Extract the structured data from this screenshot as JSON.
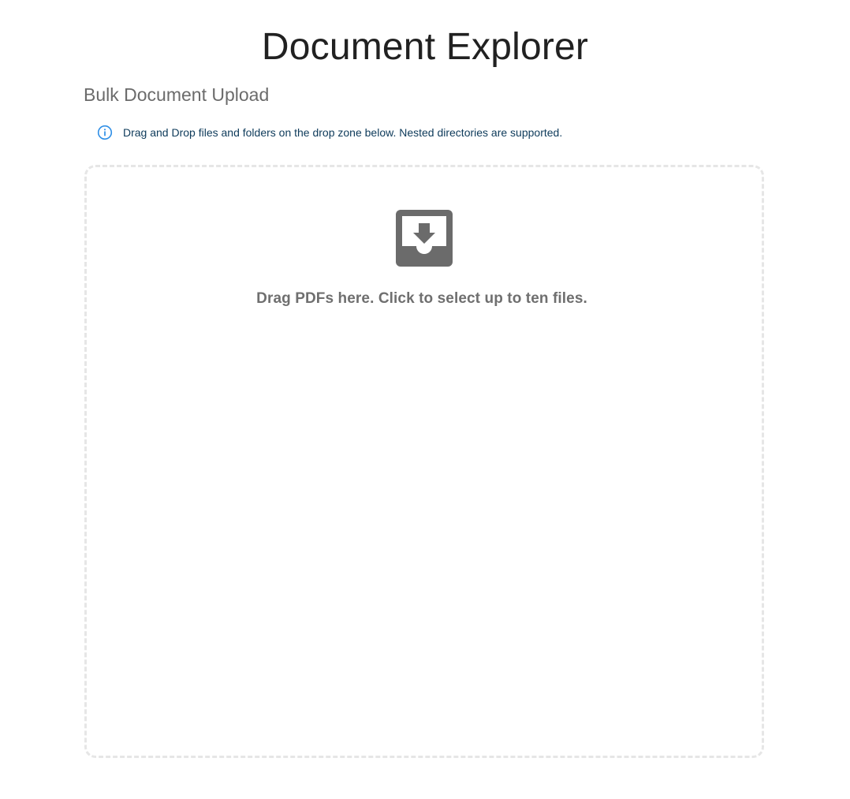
{
  "header": {
    "title": "Document Explorer"
  },
  "upload": {
    "section_title": "Bulk Document Upload",
    "info_icon": "info-icon",
    "info_text": "Drag and Drop files and folders on the drop zone below. Nested directories are supported.",
    "drop_icon": "inbox-download-icon",
    "drop_text": "Drag PDFs here. Click to select up to ten files."
  },
  "colors": {
    "info_icon": "#2f8fe6",
    "info_text": "#0d3a5a",
    "drop_icon": "#6b6b6b",
    "drop_border": "#e6e6e6"
  }
}
